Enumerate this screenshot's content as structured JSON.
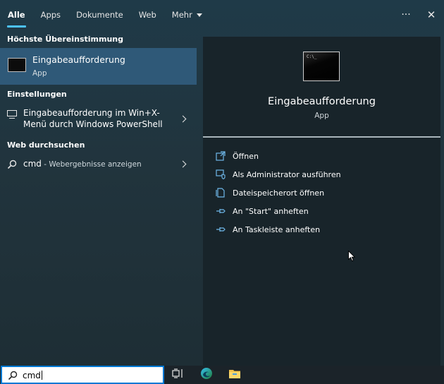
{
  "tabs": [
    {
      "label": "Alle",
      "active": true
    },
    {
      "label": "Apps"
    },
    {
      "label": "Dokumente"
    },
    {
      "label": "Web"
    },
    {
      "label": "Mehr",
      "has_caret": true
    }
  ],
  "window_controls": {
    "more_icon": "more-icon",
    "more_glyph": "···",
    "close_icon": "close-icon",
    "close_glyph": "✕"
  },
  "left": {
    "best_match_heading": "Höchste Übereinstimmung",
    "best_match": {
      "title": "Eingabeaufforderung",
      "subtitle": "App",
      "icon": "command-prompt-icon"
    },
    "settings_heading": "Einstellungen",
    "settings_item": {
      "text": "Eingabeaufforderung im Win+X-Menü durch Windows PowerShell",
      "icon": "monitor-icon"
    },
    "web_heading": "Web durchsuchen",
    "web_item": {
      "query": "cmd",
      "hint": " - Webergebnisse anzeigen",
      "icon": "search-icon"
    }
  },
  "preview": {
    "title": "Eingabeaufforderung",
    "subtitle": "App",
    "actions": [
      {
        "label": "Öffnen",
        "icon": "open-icon"
      },
      {
        "label": "Als Administrator ausführen",
        "icon": "run-as-admin-icon"
      },
      {
        "label": "Dateispeicherort öffnen",
        "icon": "file-location-icon"
      },
      {
        "label": "An \"Start\" anheften",
        "icon": "pin-icon"
      },
      {
        "label": "An Taskleiste anheften",
        "icon": "pin-icon"
      }
    ]
  },
  "taskbar": {
    "search_value": "cmd",
    "icons": [
      "task-view-icon",
      "edge-icon",
      "file-explorer-icon"
    ]
  },
  "colors": {
    "accent": "#4cc2ff",
    "selection": "#2f5978",
    "searchbox_border": "#0078d4"
  }
}
